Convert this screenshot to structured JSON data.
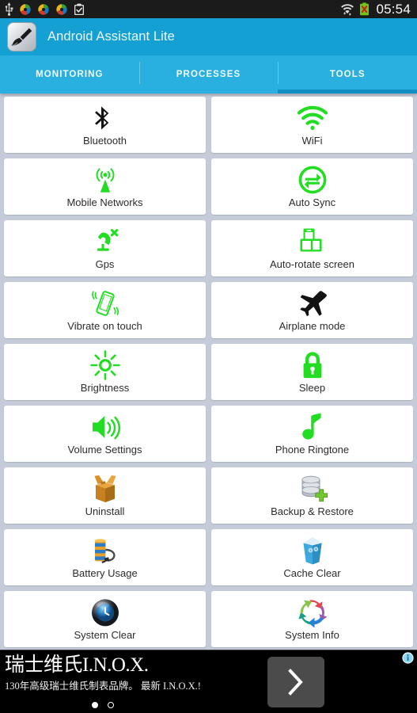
{
  "status_bar": {
    "time": "05:54",
    "left_icons": [
      {
        "name": "usb-icon",
        "label": "USB"
      },
      {
        "name": "sync-color-icon-1",
        "label": "Sync"
      },
      {
        "name": "sync-color-icon-2",
        "label": "Sync"
      },
      {
        "name": "sync-color-icon-3",
        "label": "Sync"
      },
      {
        "name": "clipboard-check-icon",
        "label": "Clipboard"
      }
    ],
    "right_icons": [
      {
        "name": "wifi-signal-icon",
        "label": "WiFi"
      },
      {
        "name": "battery-error-icon",
        "label": "Battery"
      }
    ],
    "colors": {
      "background": "#1b1b1b",
      "text": "#fafafa"
    }
  },
  "action_bar": {
    "app_title": "Android Assistant Lite",
    "icon_name": "broom-app-icon",
    "colors": {
      "background": "#14a0d2",
      "text": "#eaf6fb"
    }
  },
  "tabs": {
    "active_index": 2,
    "items": [
      {
        "label": "MONITORING",
        "name": "tab-monitoring"
      },
      {
        "label": "PROCESSES",
        "name": "tab-processes"
      },
      {
        "label": "TOOLS",
        "name": "tab-tools"
      }
    ],
    "colors": {
      "background": "#2ab0e0",
      "indicator": "#0f8fc2",
      "text": "#f2fbff"
    }
  },
  "tools": {
    "accent_green": "#22dd22",
    "items": [
      {
        "label": "Bluetooth",
        "icon": "bluetooth-icon",
        "name": "tool-bluetooth"
      },
      {
        "label": "WiFi",
        "icon": "wifi-icon",
        "name": "tool-wifi"
      },
      {
        "label": "Mobile Networks",
        "icon": "mobile-networks-icon",
        "name": "tool-mobile-networks"
      },
      {
        "label": "Auto Sync",
        "icon": "auto-sync-icon",
        "name": "tool-auto-sync"
      },
      {
        "label": "Gps",
        "icon": "gps-satellite-icon",
        "name": "tool-gps"
      },
      {
        "label": "Auto-rotate screen",
        "icon": "auto-rotate-screen-icon",
        "name": "tool-auto-rotate-screen"
      },
      {
        "label": "Vibrate on touch",
        "icon": "vibrate-icon",
        "name": "tool-vibrate-on-touch"
      },
      {
        "label": "Airplane mode",
        "icon": "airplane-icon",
        "name": "tool-airplane-mode"
      },
      {
        "label": "Brightness",
        "icon": "brightness-sun-icon",
        "name": "tool-brightness"
      },
      {
        "label": "Sleep",
        "icon": "lock-icon",
        "name": "tool-sleep"
      },
      {
        "label": "Volume Settings",
        "icon": "volume-speaker-icon",
        "name": "tool-volume-settings"
      },
      {
        "label": "Phone Ringtone",
        "icon": "music-note-icon",
        "name": "tool-phone-ringtone"
      },
      {
        "label": "Uninstall",
        "icon": "open-box-icon",
        "name": "tool-uninstall"
      },
      {
        "label": "Backup & Restore",
        "icon": "database-plus-icon",
        "name": "tool-backup-restore"
      },
      {
        "label": "Battery Usage",
        "icon": "battery-cable-icon",
        "name": "tool-battery-usage"
      },
      {
        "label": "Cache Clear",
        "icon": "recycle-bin-icon",
        "name": "tool-cache-clear"
      },
      {
        "label": "System Clear",
        "icon": "clock-orb-icon",
        "name": "tool-system-clear"
      },
      {
        "label": "System Info",
        "icon": "color-refresh-icon",
        "name": "tool-system-info"
      }
    ]
  },
  "ad": {
    "headline": "瑞士维氏I.N.O.X.",
    "subtext": "130年高级瑞士维氏制表品牌。 最新 I.N.O.X.!",
    "cta_icon": "chevron-right-icon",
    "info_icon": "ad-info-icon",
    "dots": 2,
    "active_dot": 0,
    "colors": {
      "background": "#000000",
      "cta": "#4b4b4b",
      "info": "#7fd4ef"
    }
  }
}
